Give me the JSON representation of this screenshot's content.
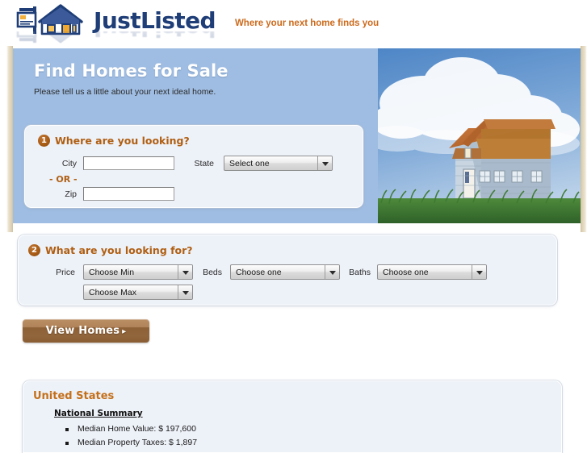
{
  "brand": {
    "name": "JustListed",
    "tagline": "Where your next home finds you",
    "logo_icon": "for-sale-sign-house-icon",
    "brand_color": "#1f3e77",
    "tagline_color": "#cc6a1c"
  },
  "hero": {
    "title": "Find Homes for Sale",
    "subtitle": "Please tell us a little about your next ideal home.",
    "background_color": "#9fbde2",
    "photo_alt": "house-on-grass-with-clouds-photo"
  },
  "step_where": {
    "number": "1",
    "heading": "Where are you looking?",
    "city_label": "City",
    "city_value": "",
    "city_placeholder": "",
    "or_text": "- OR -",
    "zip_label": "Zip",
    "zip_value": "",
    "zip_placeholder": "",
    "state_label": "State",
    "state_selected": "Select one"
  },
  "step_what": {
    "number": "2",
    "heading": "What are you looking for?",
    "price_label": "Price",
    "price_min_selected": "Choose Min",
    "price_max_selected": "Choose Max",
    "beds_label": "Beds",
    "beds_selected": "Choose one",
    "baths_label": "Baths",
    "baths_selected": "Choose one"
  },
  "actions": {
    "view_homes_label": "View Homes",
    "view_homes_caret": "▸"
  },
  "stats": {
    "region_title": "United States",
    "section_title": "National Summary",
    "items": [
      "Median Home Value: $ 197,600",
      "Median Property Taxes: $ 1,897"
    ]
  }
}
